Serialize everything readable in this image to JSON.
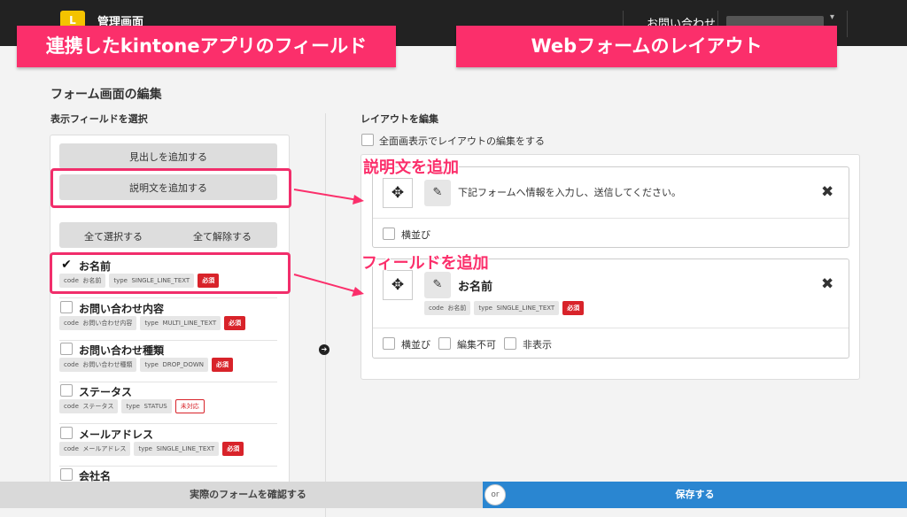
{
  "header": {
    "logo_text": "L",
    "app_title": "管理画面",
    "contact_label": "お問い合わせ",
    "user_caret": "▾"
  },
  "banners": {
    "left": "連携したkintoneアプリのフィールド",
    "right": "Webフォームのレイアウト"
  },
  "page": {
    "title": "フォーム画面の編集",
    "left_subhead": "表示フィールドを選択",
    "right_subhead": "レイアウトを編集"
  },
  "left_panel": {
    "add_heading_button": "見出しを追加する",
    "add_description_button": "説明文を追加する",
    "select_all_button": "全て選択する",
    "deselect_all_button": "全て解除する",
    "fields": [
      {
        "name": "お名前",
        "code_label": "code",
        "code": "お名前",
        "type_label": "type",
        "type": "SINGLE_LINE_TEXT",
        "badge": "必須",
        "badge_kind": "required",
        "checked": true
      },
      {
        "name": "お問い合わせ内容",
        "code_label": "code",
        "code": "お問い合わせ内容",
        "type_label": "type",
        "type": "MULTI_LINE_TEXT",
        "badge": "必須",
        "badge_kind": "required",
        "checked": false
      },
      {
        "name": "お問い合わせ種類",
        "code_label": "code",
        "code": "お問い合わせ種類",
        "type_label": "type",
        "type": "DROP_DOWN",
        "badge": "必須",
        "badge_kind": "required",
        "checked": false
      },
      {
        "name": "ステータス",
        "code_label": "code",
        "code": "ステータス",
        "type_label": "type",
        "type": "STATUS",
        "badge": "未対応",
        "badge_kind": "unsupported",
        "checked": false
      },
      {
        "name": "メールアドレス",
        "code_label": "code",
        "code": "メールアドレス",
        "type_label": "type",
        "type": "SINGLE_LINE_TEXT",
        "badge": "必須",
        "badge_kind": "required",
        "checked": false
      },
      {
        "name": "会社名",
        "checked": false
      }
    ]
  },
  "right_panel": {
    "fullscreen_label": "全面画表示でレイアウトの編集をする",
    "description_card": {
      "text": "下記フォームへ情報を入力し、送信してください。",
      "option_inline": "横並び"
    },
    "field_card": {
      "name": "お名前",
      "code_label": "code",
      "code": "お名前",
      "type_label": "type",
      "type": "SINGLE_LINE_TEXT",
      "badge": "必須",
      "option_inline": "横並び",
      "option_readonly": "編集不可",
      "option_hidden": "非表示"
    }
  },
  "annotations": {
    "add_description": "説明文を追加",
    "add_field": "フィールドを追加"
  },
  "footer": {
    "preview_button": "実際のフォームを確認する",
    "or_label": "or",
    "save_button": "保存する"
  },
  "icons": {
    "move": "✥",
    "edit": "✎",
    "close": "✖",
    "check": "✔",
    "arrow_right": "➔"
  },
  "colors": {
    "accent_pink": "#fb2f6b",
    "required_red": "#d8232a",
    "save_blue": "#2a86d1",
    "topbar": "#222222"
  }
}
